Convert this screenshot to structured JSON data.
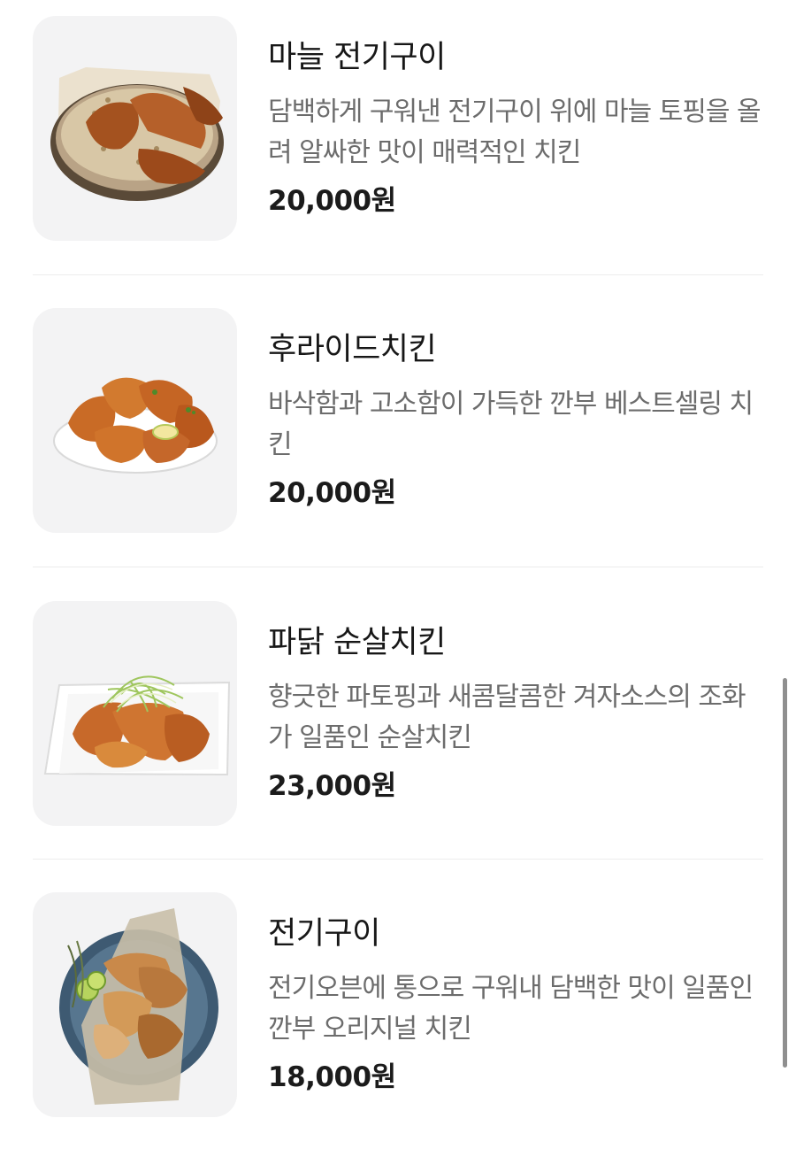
{
  "menu": {
    "items": [
      {
        "name": "마늘 전기구이",
        "description": "담백하게 구워낸 전기구이 위에 마늘 토핑을 올려 알싸한 맛이 매력적인 치킨",
        "price": "20,000원",
        "image_icon": "garlic-roast-chicken-image"
      },
      {
        "name": "후라이드치킨",
        "description": "바삭함과 고소함이 가득한 깐부 베스트셀링 치킨",
        "price": "20,000원",
        "image_icon": "fried-chicken-image"
      },
      {
        "name": "파닭 순살치킨",
        "description": "향긋한 파토핑과 새콤달콤한 겨자소스의 조화가 일품인 순살치킨",
        "price": "23,000원",
        "image_icon": "scallion-boneless-chicken-image"
      },
      {
        "name": "전기구이",
        "description": "전기오븐에 통으로 구워내 담백한 맛이 일품인 깐부 오리지널 치킨",
        "price": "18,000원",
        "image_icon": "roast-chicken-image"
      }
    ]
  },
  "colors": {
    "thumb_background": "#f3f3f4",
    "description_text": "#6c6c6c",
    "divider": "#ececec"
  }
}
